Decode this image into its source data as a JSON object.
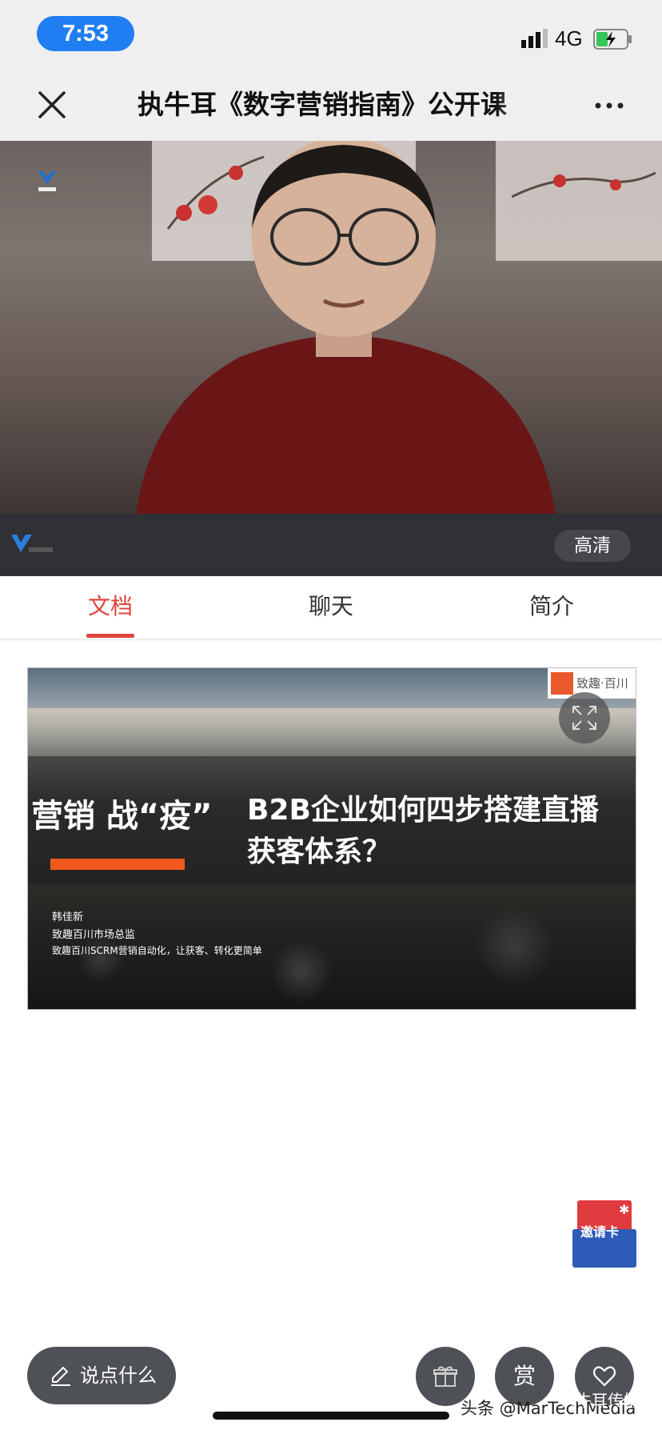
{
  "status_bar": {
    "time": "7:53",
    "network": "4G",
    "signal_icon": "signal-bars-icon",
    "battery_icon": "battery-charging-icon"
  },
  "nav": {
    "title": "执牛耳《数字营销指南》公开课",
    "close_icon": "close-icon",
    "more_icon": "more-dots-icon"
  },
  "video": {
    "quality_label": "高清"
  },
  "tabs": [
    {
      "label": "文档",
      "active": true
    },
    {
      "label": "聊天",
      "active": false
    },
    {
      "label": "简介",
      "active": false
    }
  ],
  "slide": {
    "brand": "致趣·百川",
    "title_left": "营销 战“疫”",
    "title_line1": "B2B企业如何四步搭建直播",
    "title_line2": "获客体系？",
    "speaker_name": "韩佳新",
    "speaker_role": "致趣百川市场总监",
    "speaker_slogan": "致趣百川SCRM营销自动化，让获客、转化更简单"
  },
  "invite_card": {
    "label": "邀请卡"
  },
  "bottom_bar": {
    "say_label": "说点什么",
    "reward_label": "赏",
    "gift_icon": "gift-icon",
    "like_icon": "heart-icon"
  },
  "watermark": {
    "text": "头条 @MarTechMedia",
    "secondary": "执牛耳传媒"
  },
  "colors": {
    "accent": "#e0433b",
    "time_pill": "#1f7ef2",
    "control_bg": "#2f3136",
    "button_bg": "#4e5155"
  }
}
